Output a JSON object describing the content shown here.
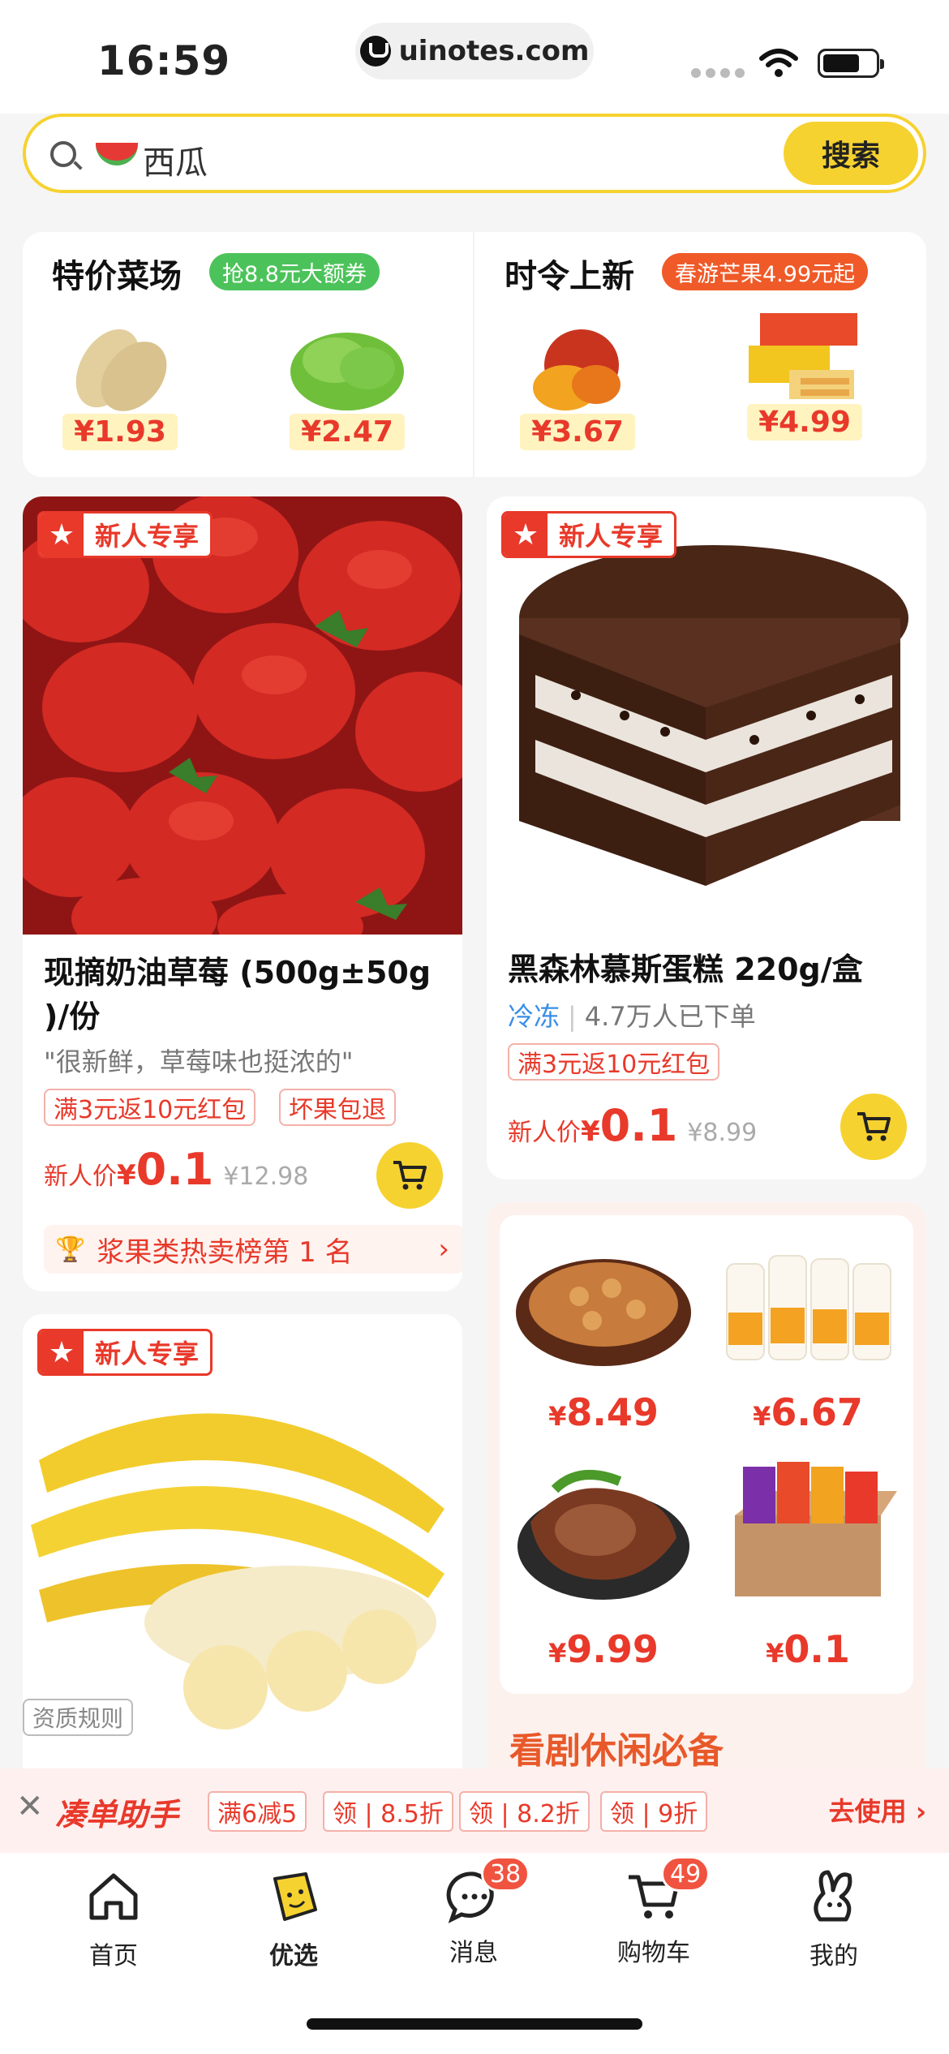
{
  "status": {
    "time": "16:59",
    "url": "uinotes.com"
  },
  "search": {
    "value": "西瓜",
    "button": "搜索"
  },
  "promo": {
    "left": {
      "title": "特价菜场",
      "badge": "抢8.8元大额券",
      "badge_color": "#4cc35a",
      "items": [
        {
          "name": "potato",
          "price": "¥1.93"
        },
        {
          "name": "lettuce",
          "price": "¥2.47"
        }
      ]
    },
    "right": {
      "title": "时令上新",
      "badge": "春游芒果4.99元起",
      "badge_color": "#ef5a28",
      "items": [
        {
          "name": "mango",
          "price": "¥3.67"
        },
        {
          "name": "wafer",
          "price": "¥4.99"
        }
      ]
    }
  },
  "products": {
    "strawberry": {
      "badge": "新人专享",
      "title_line1": "现摘奶油草莓 (500g±50g",
      "title_line2": ")/份",
      "quote": "\"很新鲜，草莓味也挺浓的\"",
      "tags": [
        "满3元返10元红包",
        "坏果包退"
      ],
      "price_label": "新人价",
      "price_symbol": "¥",
      "price": "0.1",
      "old_price": "¥12.98",
      "rank": "浆果类热卖榜第 1 名"
    },
    "cake": {
      "badge": "新人专享",
      "title": "黑森林慕斯蛋糕 220g/盒",
      "cold": "冷冻",
      "sold": "4.7万人已下单",
      "tags": [
        "满3元返10元红包"
      ],
      "price_label": "新人价",
      "price_symbol": "¥",
      "price": "0.1",
      "old_price": "¥8.99"
    },
    "banana": {
      "badge": "新人专享",
      "rules": "资质规则"
    },
    "snacks": {
      "items": [
        {
          "name": "peanuts",
          "symbol": "¥",
          "price": "8.49"
        },
        {
          "name": "yogurt",
          "symbol": "¥",
          "price": "6.67"
        },
        {
          "name": "beef",
          "symbol": "¥",
          "price": "9.99"
        },
        {
          "name": "snack-box",
          "symbol": "¥",
          "price": "0.1"
        }
      ],
      "section_title": "看剧休闲必备"
    }
  },
  "helper": {
    "title": "凑单助手",
    "chips": [
      "满6减5",
      "领 | 8.5折",
      "领 | 8.2折",
      "领 | 9折"
    ],
    "action": "去使用"
  },
  "tabs": [
    {
      "label": "首页",
      "icon": "home-icon"
    },
    {
      "label": "优选",
      "icon": "select-icon"
    },
    {
      "label": "消息",
      "icon": "message-icon",
      "badge": "38"
    },
    {
      "label": "购物车",
      "icon": "cart-icon",
      "badge": "49"
    },
    {
      "label": "我的",
      "icon": "profile-icon"
    }
  ],
  "colors": {
    "accent": "#f6d230",
    "price": "#e8392a"
  }
}
